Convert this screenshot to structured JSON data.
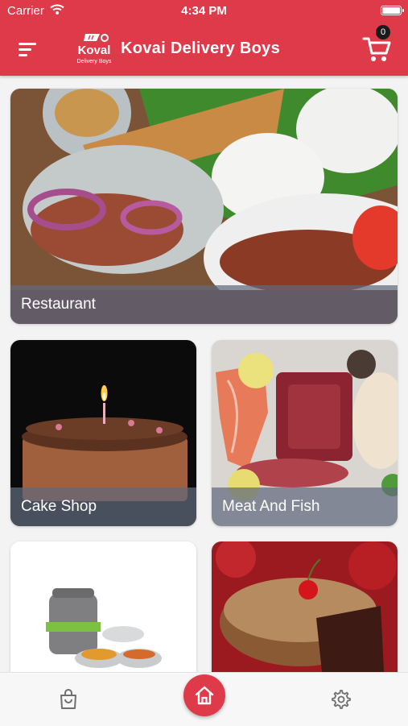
{
  "status_bar": {
    "carrier": "Carrier",
    "time": "4:34 PM"
  },
  "header": {
    "title": "Kovai Delivery Boys",
    "logo_text": "Koval",
    "logo_subtext": "Delivery Boys",
    "cart_count": "0"
  },
  "categories": [
    {
      "label": "Restaurant"
    },
    {
      "label": "Cake Shop"
    },
    {
      "label": "Meat And Fish"
    },
    {
      "label": ""
    },
    {
      "label": ""
    }
  ],
  "bottom_nav": {
    "items": [
      {
        "icon": "shopping-bag-icon"
      },
      {
        "icon": "home-icon"
      },
      {
        "icon": "gear-icon"
      }
    ]
  },
  "colors": {
    "brand": "#de3a49",
    "label_overlay": "#5f697d",
    "background": "#f3f3f3"
  }
}
